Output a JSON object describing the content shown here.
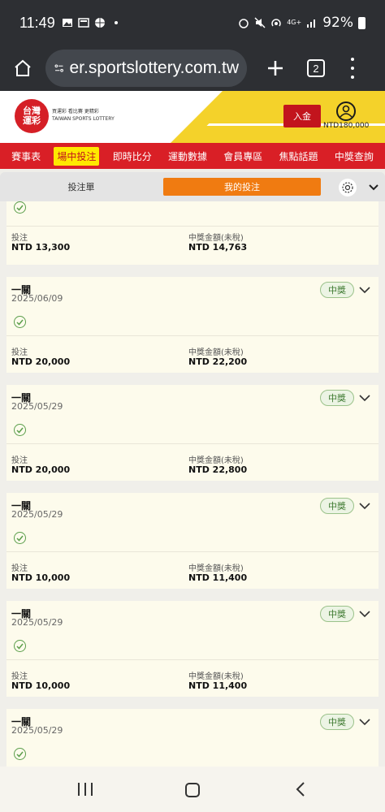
{
  "status_bar": {
    "time": "11:49",
    "battery": "92%",
    "network": "4G+"
  },
  "browser": {
    "url": "er.sportslottery.com.tw",
    "tab_count": "2"
  },
  "site": {
    "logo_line1": "台灣",
    "logo_line2": "運彩",
    "logo_tagline": "買運彩 看比賽 更精彩",
    "logo_english": "TAIWAN SPORTS LOTTERY",
    "deposit_label": "入金",
    "balance": "NTD180,000"
  },
  "nav": {
    "items": [
      {
        "label": "賽事表"
      },
      {
        "label": "場中投注"
      },
      {
        "label": "即時比分"
      },
      {
        "label": "運動數據"
      },
      {
        "label": "會員專區"
      },
      {
        "label": "焦點話題"
      },
      {
        "label": "中獎查詢"
      }
    ],
    "active_index": 1
  },
  "sub_tabs": {
    "left": "投注單",
    "right": "我的投注"
  },
  "labels": {
    "bet": "投注",
    "payout": "中獎金額(未稅)",
    "badge": "中獎"
  },
  "cards": [
    {
      "title": "",
      "date": "",
      "bet": "NTD 13,300",
      "payout": "NTD 14,763"
    },
    {
      "title": "一關",
      "date": "2025/06/09",
      "bet": "NTD 20,000",
      "payout": "NTD 22,200"
    },
    {
      "title": "一關",
      "date": "2025/05/29",
      "bet": "NTD 20,000",
      "payout": "NTD 22,800"
    },
    {
      "title": "一關",
      "date": "2025/05/29",
      "bet": "NTD 10,000",
      "payout": "NTD 11,400"
    },
    {
      "title": "一關",
      "date": "2025/05/29",
      "bet": "NTD 10,000",
      "payout": "NTD 11,400"
    },
    {
      "title": "一關",
      "date": "2025/05/29",
      "bet": "",
      "payout": ""
    }
  ],
  "colors": {
    "brand_red": "#d91f26",
    "accent_orange": "#f07b11",
    "highlight_yellow": "#ffe800",
    "win_green": "#3e7a30"
  }
}
